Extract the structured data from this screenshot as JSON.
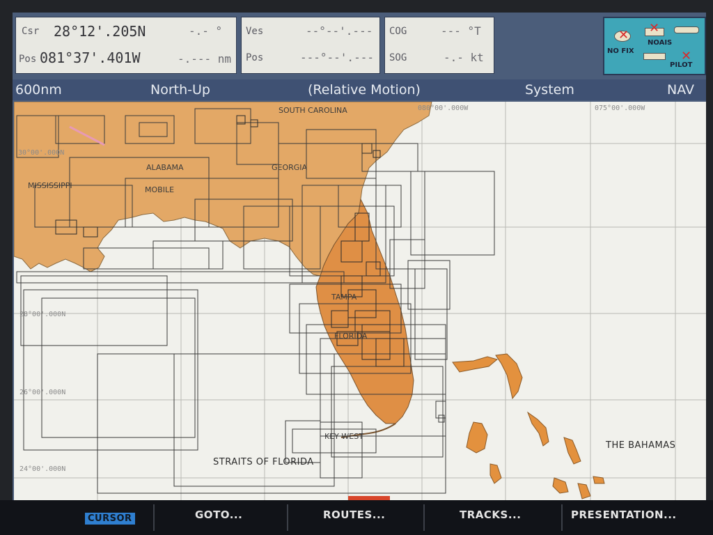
{
  "cursor_panel": {
    "csr_label": "Csr",
    "csr_lat": "28°12'.205N",
    "csr_bearing": "-.- °",
    "pos_label": "Pos",
    "pos_lon": "081°37'.401W",
    "pos_range": "-.--- nm"
  },
  "vessel_panel": {
    "ves_label": "Ves",
    "ves_value": "--°--'.---",
    "pos_label": "Pos",
    "pos_value": "---°--'.---"
  },
  "course_panel": {
    "cog_label": "COG",
    "cog_value": "--- °T",
    "sog_label": "SOG",
    "sog_value": "-.- kt"
  },
  "status_panel": {
    "nofix": "NO FIX",
    "noais": "NOAIS",
    "pilot": "PILOT"
  },
  "title_bar": {
    "range": "600nm",
    "orientation": "North-Up",
    "motion": "(Relative Motion)",
    "mode": "System",
    "nav": "NAV"
  },
  "map": {
    "labels": {
      "south_carolina": "SOUTH CAROLINA",
      "alabama": "ALABAMA",
      "georgia": "GEORGIA",
      "mississippi": "MISSISSIPPI",
      "mobile": "MOBILE",
      "tampa": "TAMPA",
      "florida": "FLORIDA",
      "key_west": "KEY WEST",
      "straits": "STRAITS OF FLORIDA",
      "bahamas": "THE BAHAMAS"
    },
    "coords": {
      "lon_80": "080°00'.000W",
      "lon_75": "075°00'.000W",
      "lat_30": "30°00'.000N",
      "lat_28": "28°00'.000N",
      "lat_26": "26°00'.000N",
      "lat_24": "24°00'.000N"
    },
    "colors": {
      "land": "#e3a866",
      "land_dark": "#df8f45",
      "sea": "#f1f1ec",
      "chart_lines": "#3a3a3a"
    }
  },
  "softkeys": {
    "cursor": "CURSOR",
    "goto": "GOTO...",
    "routes": "ROUTES...",
    "tracks": "TRACKS...",
    "presentation": "PRESENTATION..."
  }
}
